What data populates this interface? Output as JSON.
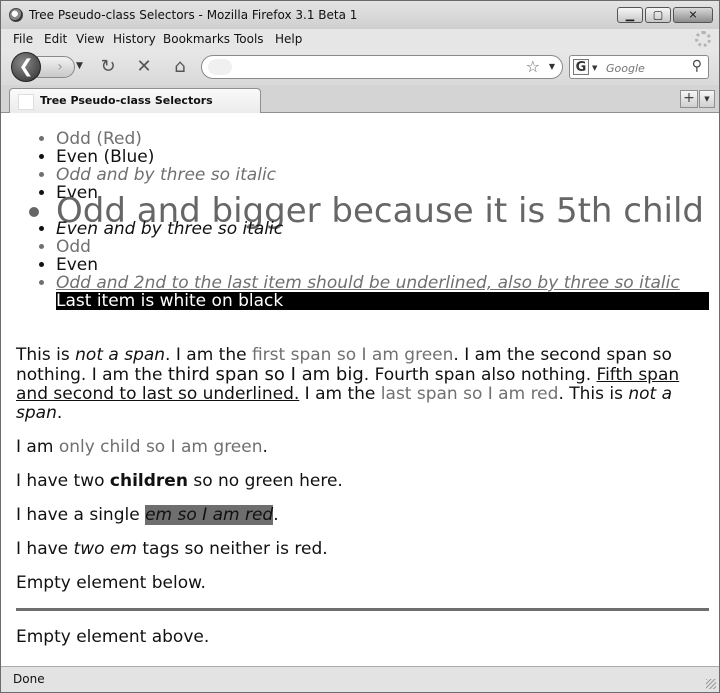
{
  "window": {
    "title": "Tree Pseudo-class Selectors - Mozilla Firefox 3.1 Beta 1",
    "buttons": {
      "minimize_glyph": "▁",
      "maximize_glyph": "▢",
      "close_glyph": "✕"
    }
  },
  "menubar": {
    "items": [
      {
        "label": "File"
      },
      {
        "label": "Edit"
      },
      {
        "label": "View"
      },
      {
        "label": "History"
      },
      {
        "label": "Bookmarks"
      },
      {
        "label": "Tools"
      },
      {
        "label": "Help"
      }
    ]
  },
  "navbar": {
    "back_glyph": "❮",
    "forward_glyph": "›",
    "dropdown_glyph": "▼",
    "reload_glyph": "↻",
    "stop_glyph": "✕",
    "home_glyph": "⌂",
    "url_value": "",
    "bookmark_star_glyph": "☆",
    "search_engine_glyph": "G",
    "search_placeholder": "Google",
    "search_icon_glyph": "⚲"
  },
  "tabs": [
    {
      "label": "Tree Pseudo-class Selectors"
    }
  ],
  "tabbar": {
    "new_tab_glyph": "+",
    "list_glyph": "▼"
  },
  "content": {
    "list": [
      "Odd (Red)",
      "Even (Blue)",
      "Odd and by three so italic",
      "Even",
      "Odd and bigger because it is 5th child",
      "Even and by three so italic",
      "Odd",
      "Even",
      "Odd and 2nd to the last item should be underlined, also by three so italic",
      "Last item is white on black"
    ],
    "p1": {
      "t1": "This is ",
      "t2": "not a span",
      "t3": ". I am the ",
      "t4": "first span so I am green",
      "t5": ". I am the second span so nothing. I am the ",
      "t6": "third span so I am big",
      "t7": ". Fourth span also nothing. ",
      "t8": "Fifth span and second to last so underlined.",
      "t9": " I am the ",
      "t10": "last span so I am red",
      "t11": ". This is ",
      "t12": "not a span",
      "t13": "."
    },
    "p2": {
      "t1": "I am ",
      "t2": "only child so I am green",
      "t3": "."
    },
    "p3": {
      "t1": "I have two ",
      "t2": "children",
      "t3": " so no green here."
    },
    "p4": {
      "t1": "I have a single ",
      "t2": "em so I am red",
      "t3": "."
    },
    "p5": {
      "t1": "I have ",
      "t2": "two em",
      "t3": " tags so neither is red."
    },
    "p6": "Empty element below.",
    "p7": "Empty element above."
  },
  "statusbar": {
    "text": "Done"
  }
}
